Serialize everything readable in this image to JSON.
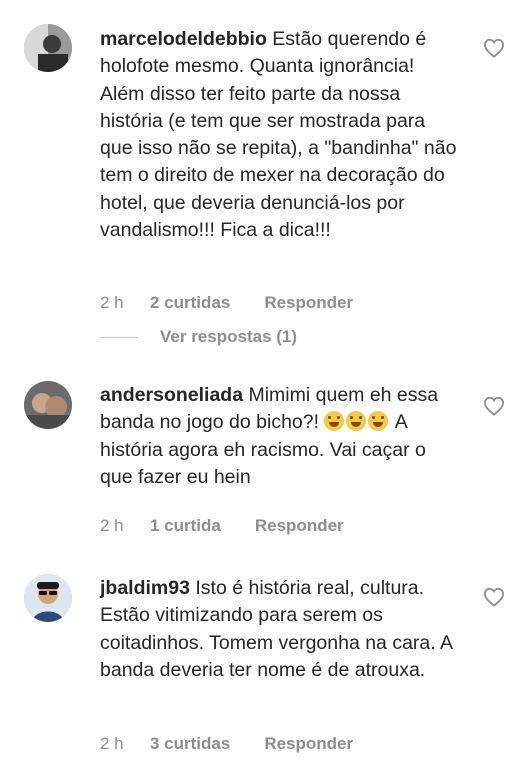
{
  "comments": [
    {
      "username": "marcelodeldebbio",
      "text": " Estão querendo é holofote mesmo. Quanta ignorância! Além disso ter feito parte da nossa história (e tem que ser mostrada para que isso não se repita), a \"bandinha\" não tem o direito de mexer na decoração do hotel, que deveria denunciá-los por vandalismo!!! Fica a dica!!!",
      "time": "2 h",
      "likes": "2 curtidas",
      "reply": "Responder",
      "view_replies": "Ver respostas (1)",
      "avatar_icon": "user-photo-avatar"
    },
    {
      "username": "andersoneliada",
      "text_before_emoji": " Mimimi quem eh essa banda no jogo do bicho?! ",
      "emojis": [
        "grinning-sweat-emoji",
        "grinning-sweat-emoji",
        "grinning-sweat-emoji"
      ],
      "text_after_emoji": " A história agora eh racismo. Vai caçar o que fazer eu hein",
      "time": "2 h",
      "likes": "1 curtida",
      "reply": "Responder",
      "avatar_icon": "user-photo-avatar"
    },
    {
      "username": "jbaldim93",
      "text": " Isto é história real, cultura. Estão vitimizando para serem os coitadinhos. Tomem vergonha na cara. A banda deveria ter nome é de atrouxa.",
      "time": "2 h",
      "likes": "3 curtidas",
      "reply": "Responder",
      "avatar_icon": "user-cartoon-avatar"
    }
  ],
  "colors": {
    "text": "#262626",
    "meta": "#8e8e8e",
    "background": "#ffffff"
  },
  "like_icon": "heart-outline-icon"
}
